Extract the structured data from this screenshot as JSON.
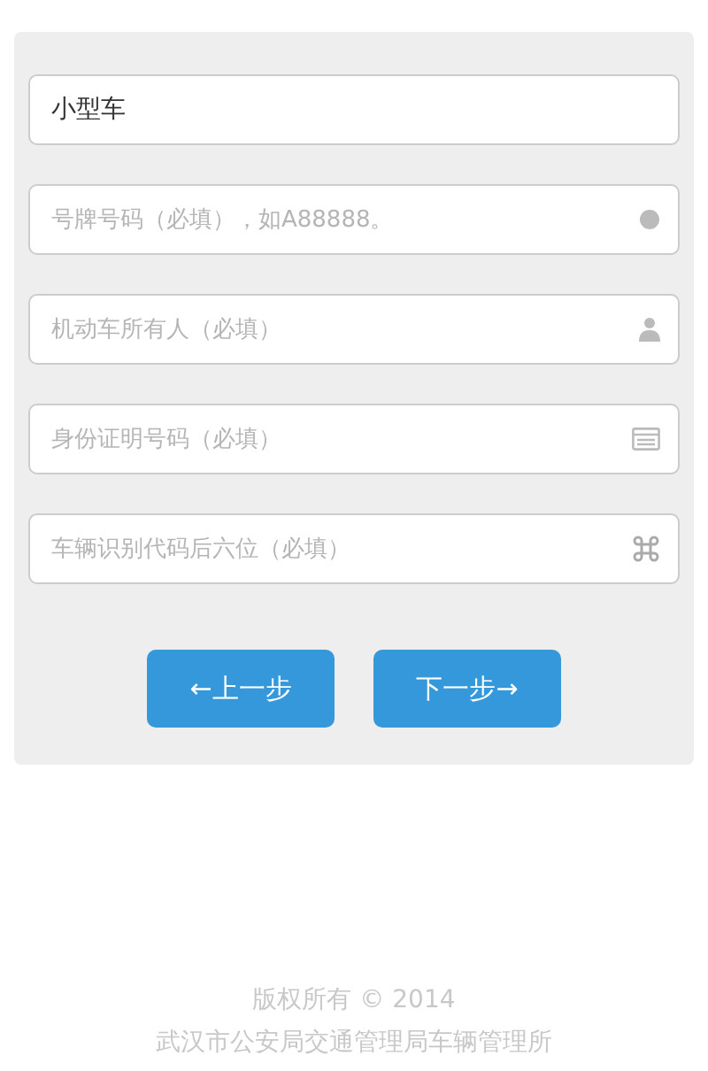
{
  "fields": [
    {
      "value": "小型车"
    },
    {
      "placeholder": "号牌号码（必填），如A88888。"
    },
    {
      "placeholder": "机动车所有人（必填）"
    },
    {
      "placeholder": "身份证明号码（必填）"
    },
    {
      "placeholder": "车辆识别代码后六位（必填）"
    }
  ],
  "buttons": [
    {
      "label": "←上一步"
    },
    {
      "label": "下一步→"
    }
  ],
  "footer": {
    "copyright": "版权所有 © 2014",
    "org": "武汉市公安局交通管理局车辆管理所"
  }
}
